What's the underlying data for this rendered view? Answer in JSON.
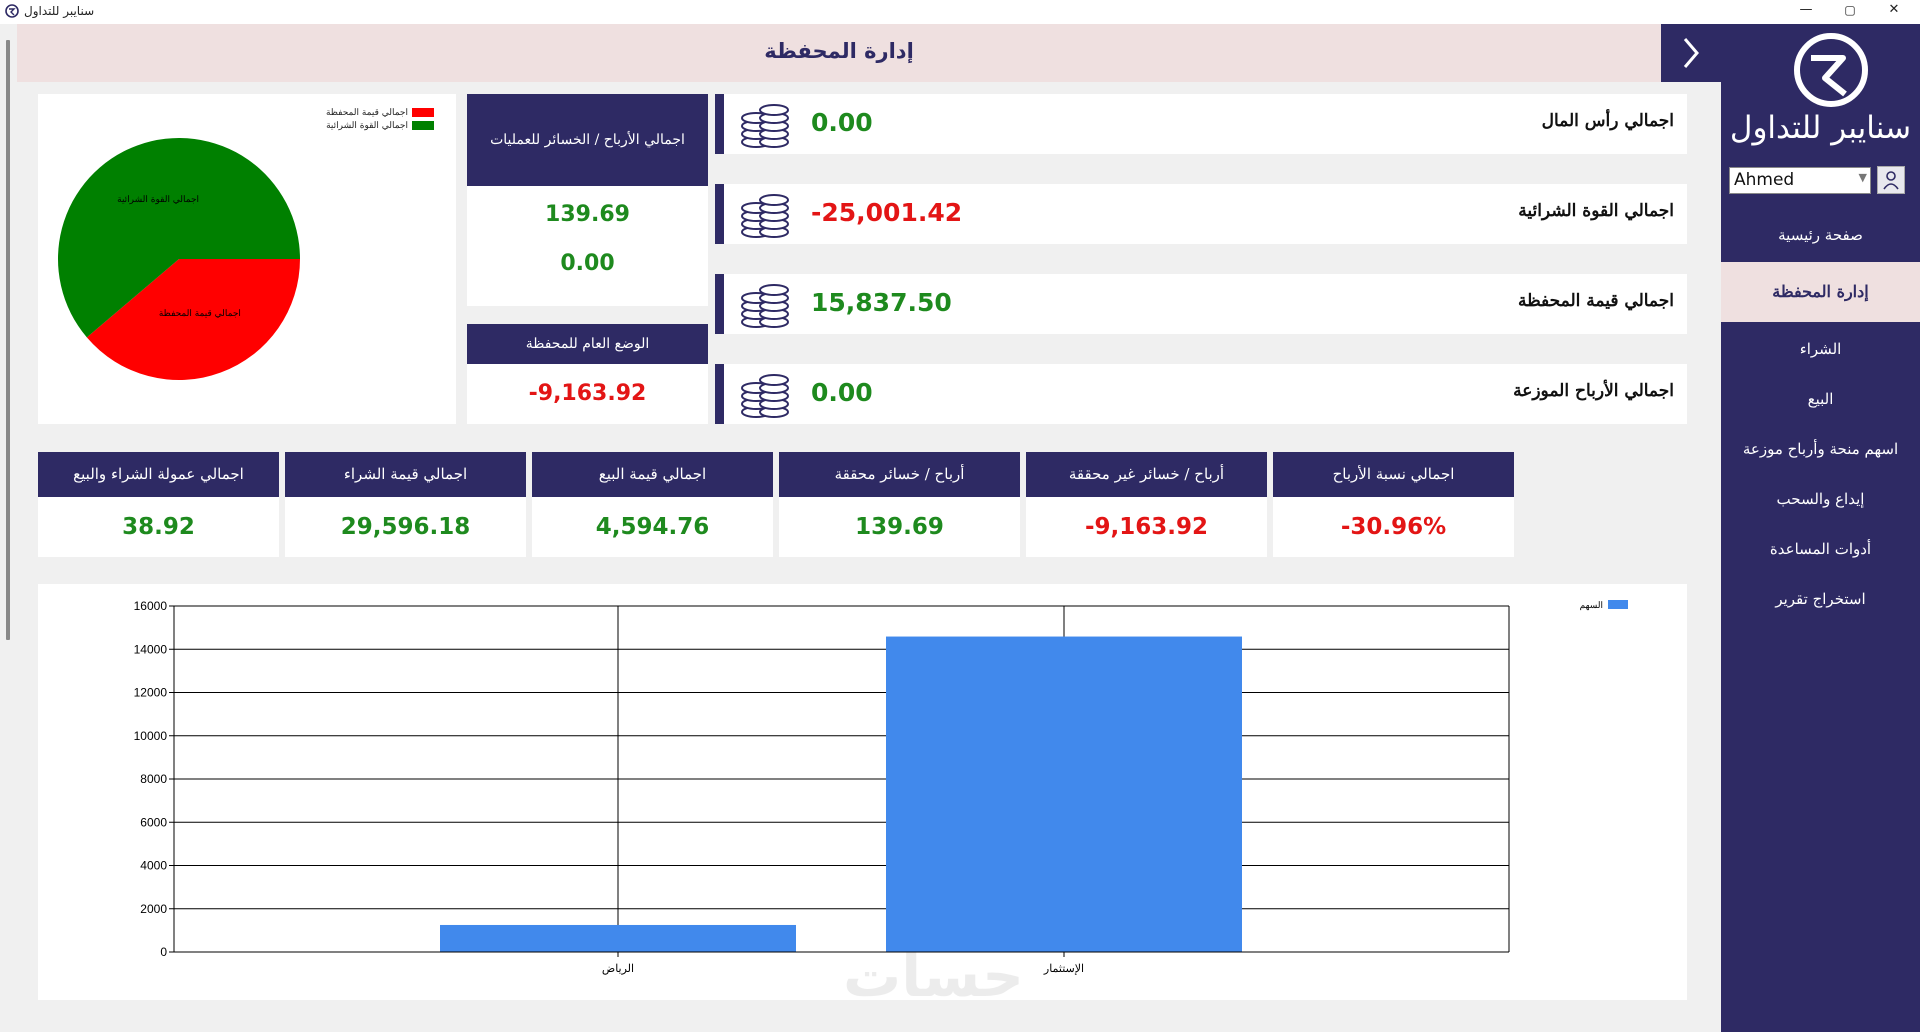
{
  "window": {
    "title": "سنايبر للتداول",
    "min": "—",
    "max": "▢",
    "close": "✕"
  },
  "header": {
    "title": "إدارة المحفظة",
    "collapse_icon": "chevron-right-icon"
  },
  "sidebar": {
    "brand": "سنايبر للتداول",
    "user": "Ahmed",
    "items": [
      {
        "label": "صفحة رئيسية",
        "active": false
      },
      {
        "label": "إدارة المحفظة",
        "active": true
      },
      {
        "label": "الشراء",
        "active": false
      },
      {
        "label": "البيع",
        "active": false
      },
      {
        "label": "اسهم منحة وأرباح موزعة",
        "active": false
      },
      {
        "label": "إيداع والسحب",
        "active": false
      },
      {
        "label": "أدوات المساعدة",
        "active": false
      },
      {
        "label": "استخراج تقرير",
        "active": false
      }
    ]
  },
  "stats": [
    {
      "label": "اجمالي رأس المال",
      "value": "0.00",
      "color": "#1e8a1e"
    },
    {
      "label": "اجمالي القوة الشرائية",
      "value": "-25,001.42",
      "color": "#e31515"
    },
    {
      "label": "اجمالي قيمة المحفظة",
      "value": "15,837.50",
      "color": "#1e8a1e"
    },
    {
      "label": "اجمالي الأرباح الموزعة",
      "value": "0.00",
      "color": "#1e8a1e"
    }
  ],
  "operations": {
    "title": "اجمالي الأرباح / الخسائر للعمليات",
    "value1": "139.69",
    "value2": "0.00"
  },
  "overall": {
    "title": "الوضع العام للمحفظة",
    "value": "-9,163.92"
  },
  "kpis": [
    {
      "label": "اجمالي نسبة الأرباح",
      "value": "-30.96%",
      "color": "#e31515"
    },
    {
      "label": "أرباح / خسائر غير محققة",
      "value": "-9,163.92",
      "color": "#e31515"
    },
    {
      "label": "أرباح / خسائر محققة",
      "value": "139.69",
      "color": "#1e8a1e"
    },
    {
      "label": "اجمالي قيمة البيع",
      "value": "4,594.76",
      "color": "#1e8a1e"
    },
    {
      "label": "اجمالي قيمة الشراء",
      "value": "29,596.18",
      "color": "#1e8a1e"
    },
    {
      "label": "اجمالي عمولة الشراء والبيع",
      "value": "38.92",
      "color": "#1e8a1e"
    }
  ],
  "chart_data": [
    {
      "type": "pie",
      "legend": "top-right",
      "slices": [
        {
          "name": "اجمالي قيمة المحفظة",
          "value": 38.78,
          "color": "#ff0000"
        },
        {
          "name": "اجمالي القوة الشرائية",
          "value": 61.22,
          "color": "#008000"
        }
      ]
    },
    {
      "type": "bar",
      "categories": [
        "الرياض",
        "الإستثمار"
      ],
      "series": [
        {
          "name": "السهم",
          "values": [
            1250,
            14587.5
          ],
          "color": "#4189ec"
        }
      ],
      "ylim": [
        0,
        16000
      ],
      "yticks": [
        0,
        2000,
        4000,
        6000,
        8000,
        10000,
        12000,
        14000,
        16000
      ],
      "grid": true,
      "legend": "top-right"
    }
  ],
  "watermark": "حسات"
}
